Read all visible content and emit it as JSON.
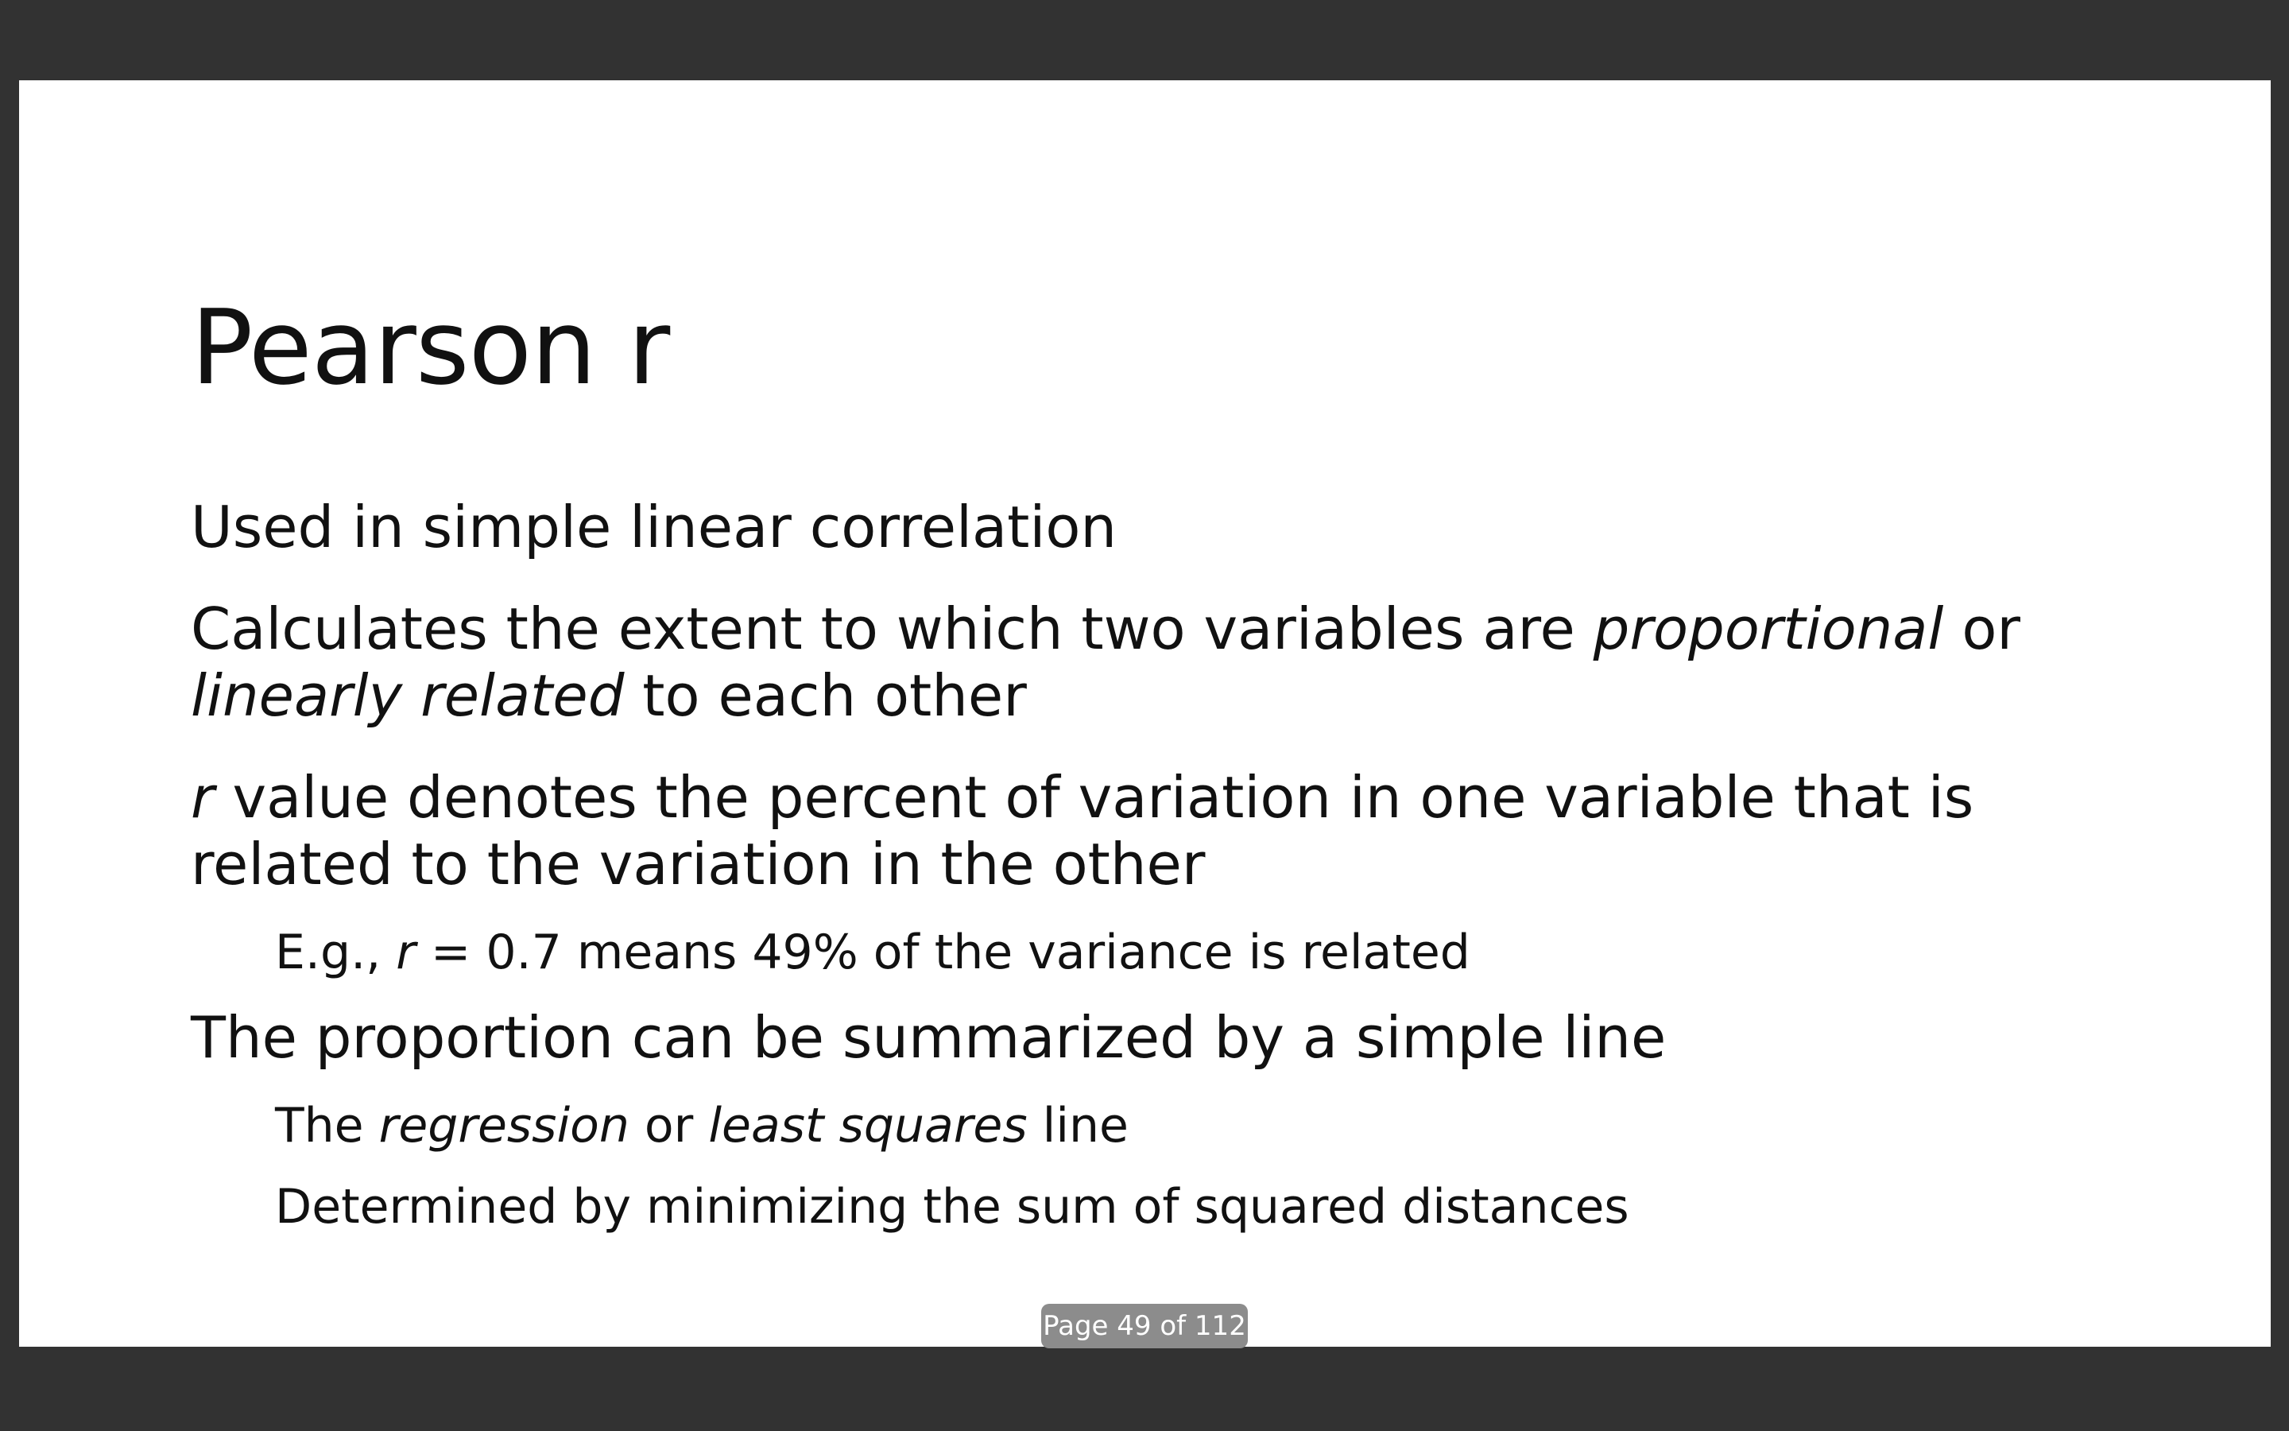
{
  "slide": {
    "title": "Pearson r",
    "bullets": {
      "b1": "Used in simple linear correlation",
      "b2": {
        "part1": "Calculates the extent to which two variables are ",
        "em1": "proportional",
        "part2": " or",
        "em2": "linearly related",
        "part3": " to each other"
      },
      "b3": {
        "em1": "r",
        "line1": " value denotes the percent of variation in one variable that is",
        "line2": "related to the variation in the other"
      },
      "b3_sub": {
        "part1": "E.g., ",
        "em1": "r",
        "part2": " = 0.7 means 49% of the variance is related"
      },
      "b4": "The proportion can be summarized by a simple line",
      "b4_sub1": {
        "part1": "The ",
        "em1": "regression",
        "part2": " or ",
        "em2": "least squares",
        "part3": " line"
      },
      "b4_sub2": "Determined by minimizing the sum of squared distances"
    }
  },
  "pager": {
    "label": "Page 49 of 112"
  },
  "colors": {
    "viewer_background": "#323232",
    "slide_background": "#ffffff",
    "pager_background": "#8c8c8c"
  }
}
